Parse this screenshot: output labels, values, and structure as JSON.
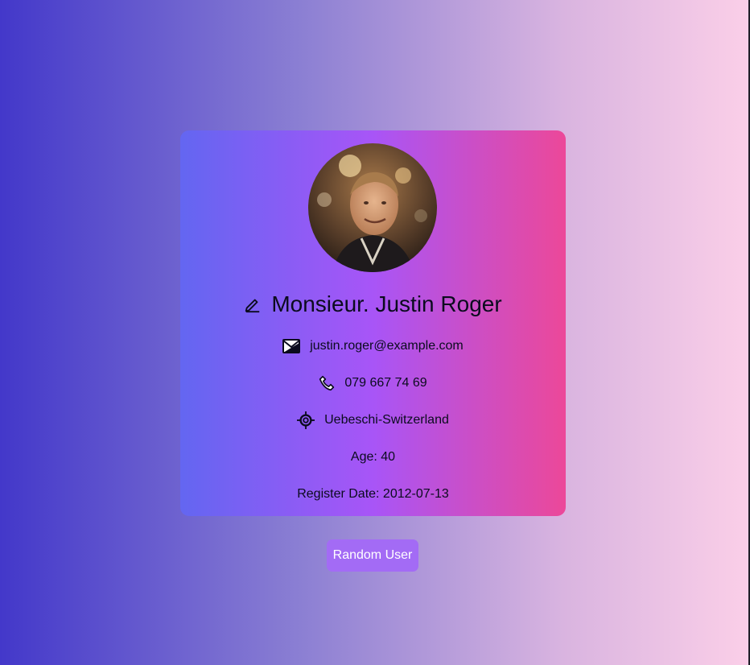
{
  "profile": {
    "name": "Monsieur. Justin Roger",
    "email": "justin.roger@example.com",
    "phone": "079 667 74 69",
    "location": "Uebeschi-Switzerland",
    "age": "Age: 40",
    "register_date": "Register Date: 2012-07-13",
    "avatar": "person-photo"
  },
  "actions": {
    "random_user_label": "Random User"
  },
  "icons": {
    "name": "pencil-icon",
    "email": "envelope-icon",
    "phone": "phone-icon",
    "location": "crosshair-icon"
  },
  "colors": {
    "background_start": "#4338ca",
    "background_end": "#fbcfe8",
    "card_start": "#6366f1",
    "card_mid": "#a855f7",
    "card_end": "#ec4899",
    "button": "#a36bf5",
    "text": "#0b0b1e"
  }
}
